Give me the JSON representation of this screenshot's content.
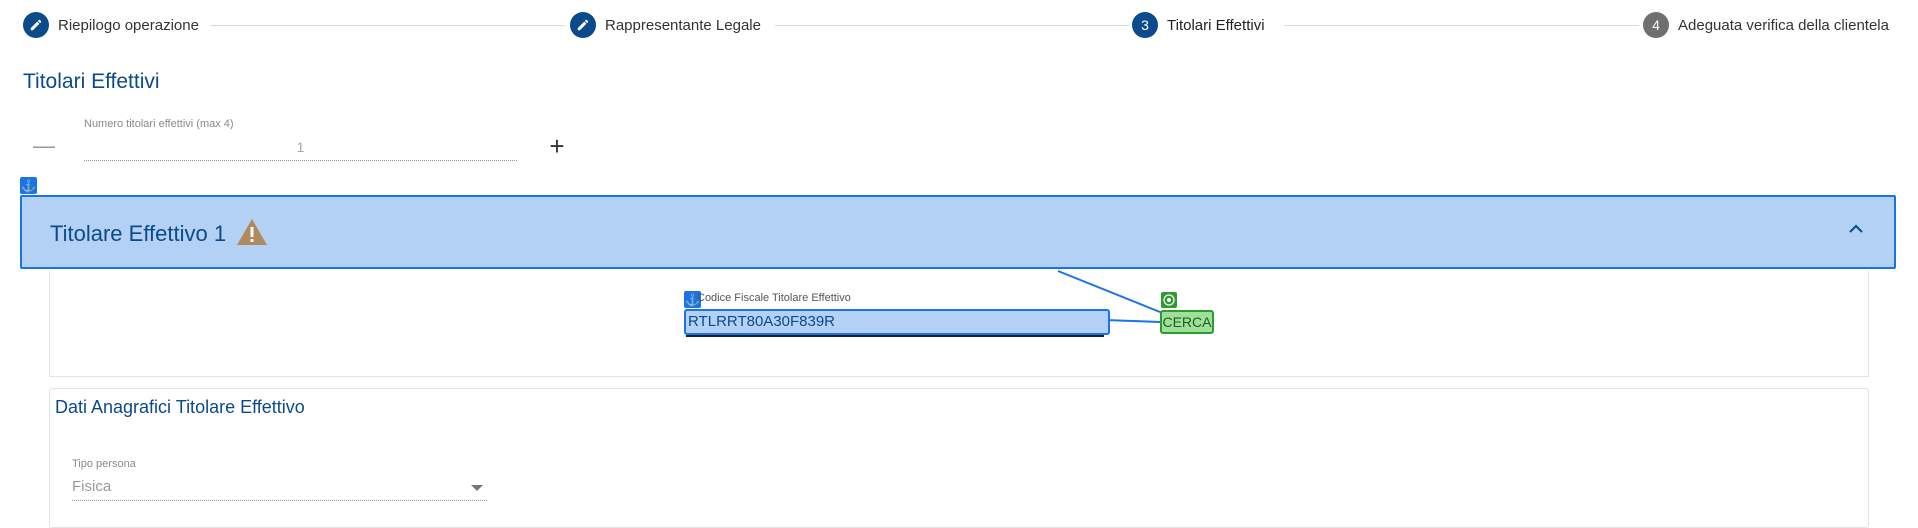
{
  "stepper": {
    "steps": [
      {
        "label": "Riepilogo operazione",
        "icon": "pencil-icon",
        "state": "done"
      },
      {
        "label": "Rappresentante Legale",
        "icon": "pencil-icon",
        "state": "done"
      },
      {
        "label": "Titolari Effettivi",
        "number": "3",
        "state": "active"
      },
      {
        "label": "Adeguata verifica della clientela",
        "number": "4",
        "state": "todo"
      }
    ]
  },
  "section": {
    "title": "Titolari Effettivi"
  },
  "counter": {
    "label": "Numero titolari effettivi (max 4)",
    "value": "1",
    "minus": "—",
    "plus": "+"
  },
  "accordion": {
    "title": "Titolare Effettivo 1",
    "codice_fiscale_label": "Codice Fiscale Titolare Effettivo",
    "codice_fiscale_value": "RTLRRT80A30F839R",
    "cerca_label": "CERCA"
  },
  "anagrafica": {
    "title": "Dati Anagrafici Titolare Effettivo",
    "tipo_persona_label": "Tipo persona",
    "tipo_persona_value": "Fisica"
  },
  "colors": {
    "primary": "#0b4a8b",
    "highlight": "#b3d0f5",
    "accent": "#1a73e8",
    "warning": "#b08a5a",
    "success": "#2e9b2e"
  }
}
